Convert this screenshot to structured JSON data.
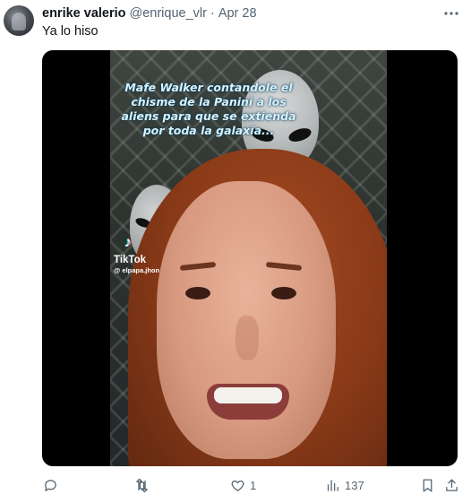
{
  "author": {
    "display_name": "enrike valerio",
    "handle": "@enrique_vlr",
    "separator": "·",
    "date": "Apr 28"
  },
  "tweet": {
    "text": "Ya lo hiso"
  },
  "media": {
    "caption": "Mafe Walker  contandole el chisme de la Panini a los aliens para que se extienda por toda la galaxia...",
    "watermark_name": "TikTok",
    "watermark_user": "@ elpapa.jhon"
  },
  "actions": {
    "reply_count": "",
    "retweet_count": "",
    "like_count": "1",
    "views_count": "137"
  },
  "icons": {
    "more": "more-dots-icon",
    "reply": "reply-icon",
    "retweet": "retweet-icon",
    "like": "heart-icon",
    "views": "views-icon",
    "bookmark": "bookmark-icon",
    "share": "share-icon"
  },
  "colors": {
    "text_primary": "#0f1419",
    "text_secondary": "#536471",
    "media_background": "#000000"
  }
}
